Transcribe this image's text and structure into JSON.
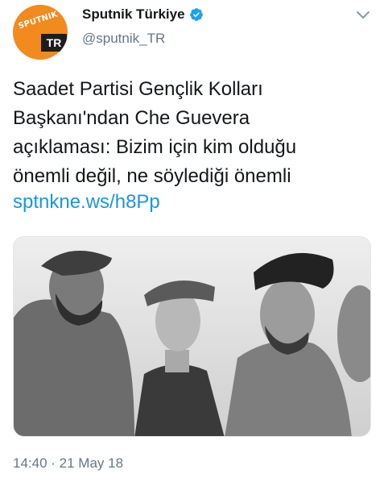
{
  "account": {
    "display_name": "Sputnik Türkiye",
    "handle": "@sputnik_TR",
    "avatar_logo_top": "SPUTNIK",
    "avatar_logo_tr": "TR"
  },
  "tweet": {
    "text_lines": [
      "Saadet Partisi Gençlik Kolları",
      "Başkanı'ndan Che Guevera",
      "açıklaması: Bizim için kim olduğu",
      "önemli değil, ne söylediği önemli"
    ],
    "link": "sptnkne.ws/h8Pp",
    "timestamp": "14:40 · 21 May 18"
  },
  "colors": {
    "brand_orange": "#f28a1e",
    "link_blue": "#1b95e0",
    "verified_blue": "#1da1f2",
    "secondary_text": "#657786"
  },
  "icons": {
    "verified": "verified-badge-icon",
    "more": "chevron-down-icon"
  }
}
